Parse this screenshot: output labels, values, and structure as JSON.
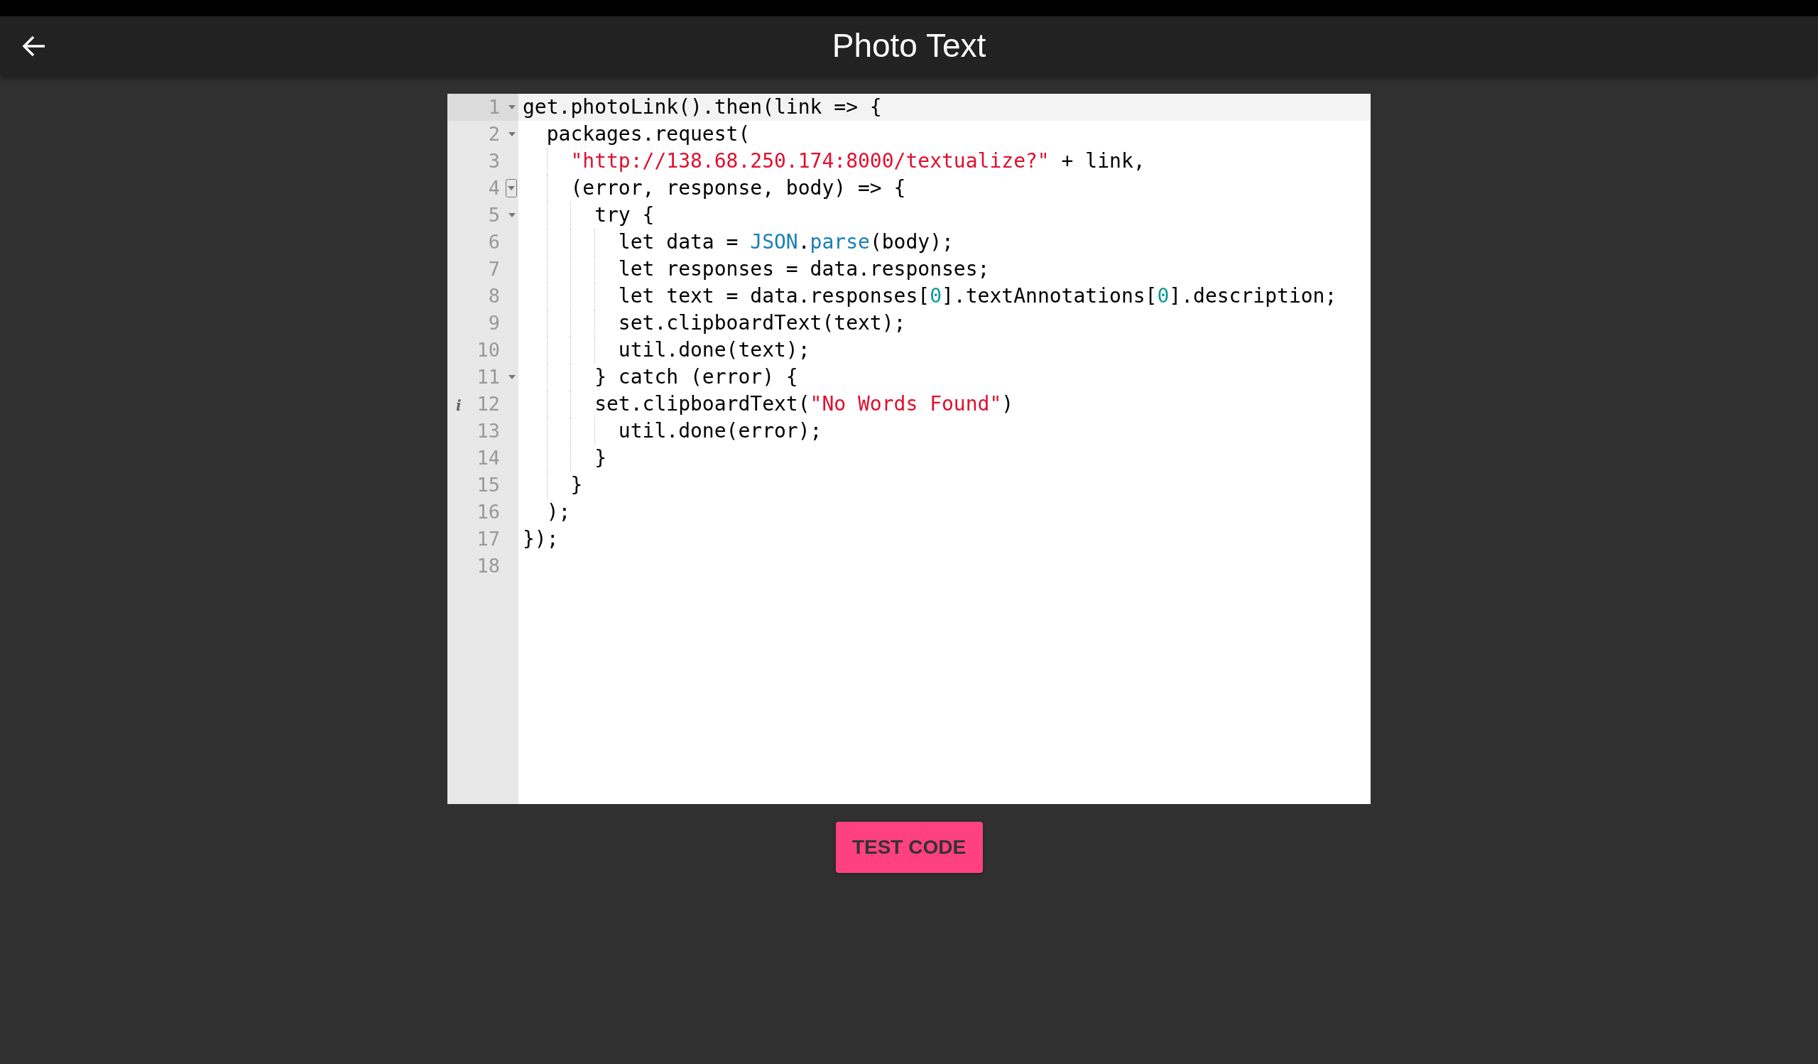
{
  "header": {
    "title": "Photo Text"
  },
  "editor": {
    "lines": [
      {
        "number": "1",
        "foldable": true,
        "hovered": false,
        "active": true,
        "tokens": [
          {
            "kind": "plain",
            "text": "get.photoLink().then(link => {"
          }
        ]
      },
      {
        "number": "2",
        "foldable": true,
        "hovered": false,
        "active": false,
        "tokens": [
          {
            "kind": "plain",
            "text": "  packages.request("
          }
        ]
      },
      {
        "number": "3",
        "foldable": false,
        "hovered": false,
        "active": false,
        "tokens": [
          {
            "kind": "string",
            "text": "    \"http://138.68.250.174:8000/textualize?\""
          },
          {
            "kind": "plain",
            "text": " + link,"
          }
        ]
      },
      {
        "number": "4",
        "foldable": true,
        "hovered": true,
        "active": false,
        "tokens": [
          {
            "kind": "plain",
            "text": "    (error, response, body) => {"
          }
        ]
      },
      {
        "number": "5",
        "foldable": true,
        "hovered": false,
        "active": false,
        "tokens": [
          {
            "kind": "plain",
            "text": "      try {"
          }
        ]
      },
      {
        "number": "6",
        "foldable": false,
        "hovered": false,
        "active": false,
        "tokens": [
          {
            "kind": "plain",
            "text": "        let data = "
          },
          {
            "kind": "builtin",
            "text": "JSON"
          },
          {
            "kind": "plain",
            "text": "."
          },
          {
            "kind": "builtin",
            "text": "parse"
          },
          {
            "kind": "plain",
            "text": "(body);"
          }
        ]
      },
      {
        "number": "7",
        "foldable": false,
        "hovered": false,
        "active": false,
        "tokens": [
          {
            "kind": "plain",
            "text": "        let responses = data.responses;"
          }
        ]
      },
      {
        "number": "8",
        "foldable": false,
        "hovered": false,
        "active": false,
        "tokens": [
          {
            "kind": "plain",
            "text": "        let text = data.responses["
          },
          {
            "kind": "number",
            "text": "0"
          },
          {
            "kind": "plain",
            "text": "].textAnnotations["
          },
          {
            "kind": "number",
            "text": "0"
          },
          {
            "kind": "plain",
            "text": "].description;"
          }
        ]
      },
      {
        "number": "9",
        "foldable": false,
        "hovered": false,
        "active": false,
        "tokens": [
          {
            "kind": "plain",
            "text": "        set.clipboardText(text);"
          }
        ]
      },
      {
        "number": "10",
        "foldable": false,
        "hovered": false,
        "active": false,
        "tokens": [
          {
            "kind": "plain",
            "text": "        util.done(text);"
          }
        ]
      },
      {
        "number": "11",
        "foldable": true,
        "hovered": false,
        "active": false,
        "tokens": [
          {
            "kind": "plain",
            "text": "      } catch (error) {"
          }
        ]
      },
      {
        "number": "12",
        "foldable": false,
        "hovered": false,
        "active": false,
        "annotation": "i",
        "tokens": [
          {
            "kind": "plain",
            "text": "      set.clipboardText("
          },
          {
            "kind": "string",
            "text": "\"No Words Found\""
          },
          {
            "kind": "plain",
            "text": ")"
          }
        ]
      },
      {
        "number": "13",
        "foldable": false,
        "hovered": false,
        "active": false,
        "tokens": [
          {
            "kind": "plain",
            "text": "        util.done(error);"
          }
        ]
      },
      {
        "number": "14",
        "foldable": false,
        "hovered": false,
        "active": false,
        "tokens": [
          {
            "kind": "plain",
            "text": "      }"
          }
        ]
      },
      {
        "number": "15",
        "foldable": false,
        "hovered": false,
        "active": false,
        "tokens": [
          {
            "kind": "plain",
            "text": "    }"
          }
        ]
      },
      {
        "number": "16",
        "foldable": false,
        "hovered": false,
        "active": false,
        "tokens": [
          {
            "kind": "plain",
            "text": "  );"
          }
        ]
      },
      {
        "number": "17",
        "foldable": false,
        "hovered": false,
        "active": false,
        "tokens": [
          {
            "kind": "plain",
            "text": "});"
          }
        ]
      },
      {
        "number": "18",
        "foldable": false,
        "hovered": false,
        "active": false
      }
    ]
  },
  "button": {
    "label": "TEST CODE"
  }
}
